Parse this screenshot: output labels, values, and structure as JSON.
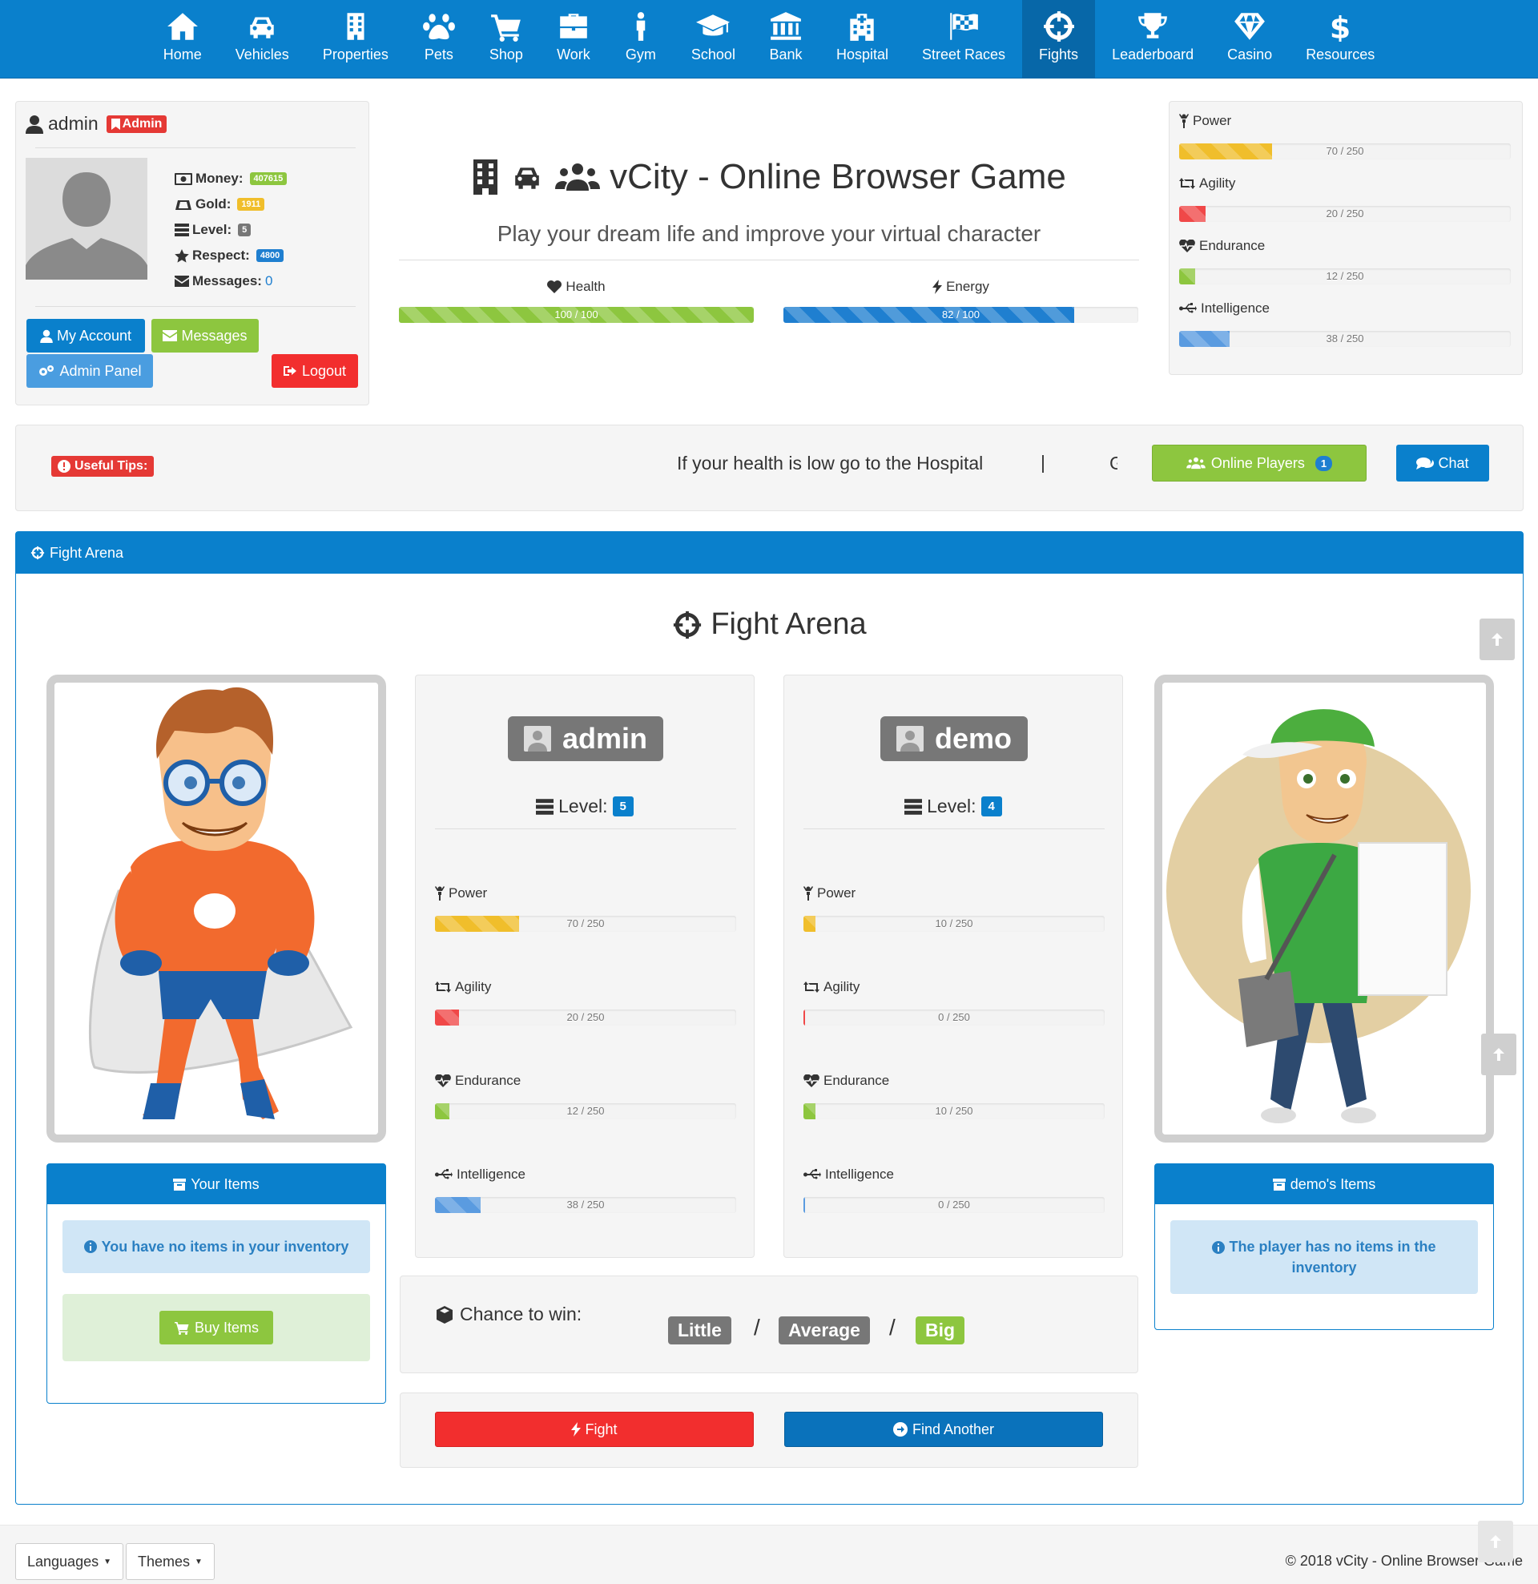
{
  "nav": [
    {
      "label": "Home",
      "icon": "home-icon"
    },
    {
      "label": "Vehicles",
      "icon": "car-icon"
    },
    {
      "label": "Properties",
      "icon": "building-icon"
    },
    {
      "label": "Pets",
      "icon": "paw-icon"
    },
    {
      "label": "Shop",
      "icon": "cart-icon"
    },
    {
      "label": "Work",
      "icon": "briefcase-icon"
    },
    {
      "label": "Gym",
      "icon": "person-icon"
    },
    {
      "label": "School",
      "icon": "graduation-cap-icon"
    },
    {
      "label": "Bank",
      "icon": "bank-icon"
    },
    {
      "label": "Hospital",
      "icon": "hospital-icon"
    },
    {
      "label": "Street Races",
      "icon": "checkered-flag-icon"
    },
    {
      "label": "Fights",
      "icon": "crosshairs-icon",
      "active": true
    },
    {
      "label": "Leaderboard",
      "icon": "trophy-icon"
    },
    {
      "label": "Casino",
      "icon": "diamond-icon"
    },
    {
      "label": "Resources",
      "icon": "dollar-icon"
    }
  ],
  "user": {
    "name": "admin",
    "role_badge": "Admin",
    "money_label": "Money:",
    "money": "407615",
    "gold_label": "Gold:",
    "gold": "1911",
    "level_label": "Level:",
    "level": "5",
    "respect_label": "Respect:",
    "respect": "4800",
    "messages_label": "Messages:",
    "messages": "0",
    "buttons": {
      "account": "My Account",
      "messages": "Messages",
      "admin": "Admin Panel",
      "logout": "Logout"
    }
  },
  "header": {
    "title": "vCity - Online Browser Game",
    "subtitle": "Play your dream life and improve your virtual character",
    "health_label": "Health",
    "health_text": "100 / 100",
    "health_value": 100,
    "health_max": 100,
    "energy_label": "Energy",
    "energy_text": "82 / 100",
    "energy_value": 82,
    "energy_max": 100
  },
  "side_stats": [
    {
      "label": "Power",
      "text": "70 / 250",
      "value": 70,
      "max": 250
    },
    {
      "label": "Agility",
      "text": "20 / 250",
      "value": 20,
      "max": 250
    },
    {
      "label": "Endurance",
      "text": "12 / 250",
      "value": 12,
      "max": 250
    },
    {
      "label": "Intelligence",
      "text": "38 / 250",
      "value": 38,
      "max": 250
    }
  ],
  "tips": {
    "label": "Useful Tips:",
    "text": "If your health is low go to the Hospital",
    "separator": "|",
    "next_char": "G",
    "online_label": "Online Players",
    "online_count": "1",
    "chat_label": "Chat"
  },
  "arena": {
    "panel_title": "Fight Arena",
    "heading": "Fight Arena",
    "player": {
      "name": "admin",
      "level_label": "Level:",
      "level": "5",
      "stats": [
        {
          "label": "Power",
          "text": "70 / 250",
          "value": 70,
          "max": 250
        },
        {
          "label": "Agility",
          "text": "20 / 250",
          "value": 20,
          "max": 250
        },
        {
          "label": "Endurance",
          "text": "12 / 250",
          "value": 12,
          "max": 250
        },
        {
          "label": "Intelligence",
          "text": "38 / 250",
          "value": 38,
          "max": 250
        }
      ],
      "items_title": "Your Items",
      "items_empty": "You have no items in your inventory",
      "buy_label": "Buy Items"
    },
    "opponent": {
      "name": "demo",
      "level_label": "Level:",
      "level": "4",
      "stats": [
        {
          "label": "Power",
          "text": "10 / 250",
          "value": 10,
          "max": 250
        },
        {
          "label": "Agility",
          "text": "0 / 250",
          "value": 0,
          "max": 250
        },
        {
          "label": "Endurance",
          "text": "10 / 250",
          "value": 10,
          "max": 250
        },
        {
          "label": "Intelligence",
          "text": "0 / 250",
          "value": 0,
          "max": 250
        }
      ],
      "items_title": "demo's Items",
      "items_empty": "The player has no items in the inventory"
    },
    "chance_label": "Chance to win:",
    "chance": {
      "little": "Little",
      "average": "Average",
      "big": "Big",
      "highlighted": "big"
    },
    "fight_label": "Fight",
    "find_label": "Find Another"
  },
  "footer": {
    "languages": "Languages",
    "themes": "Themes",
    "copyright": "© 2018 vCity - Online Browser Game"
  },
  "colors": {
    "primary": "#0a80cc",
    "power": "#f0be2b",
    "agility": "#f04848",
    "endurance": "#8dc63f",
    "intelligence": "#5a9be0",
    "health": "#8dc63f",
    "energy": "#1f7fd0",
    "danger": "#f22e2e",
    "success": "#8dc63f"
  }
}
